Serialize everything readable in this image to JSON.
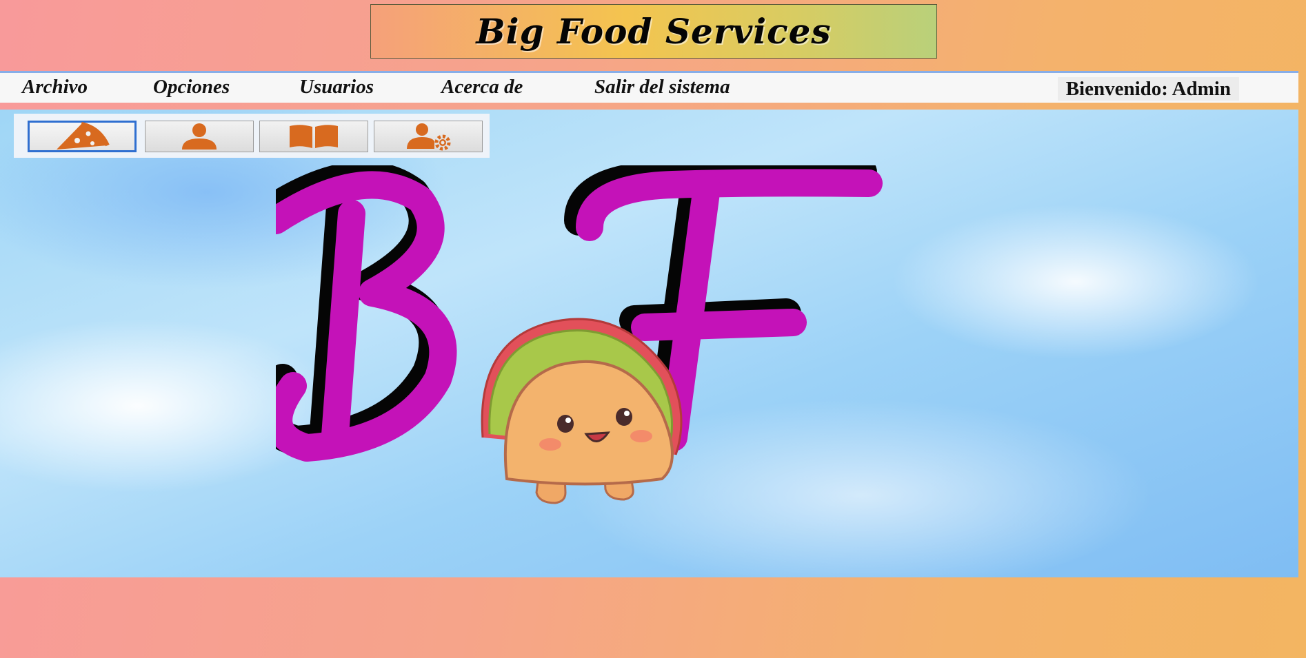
{
  "app": {
    "title": "Big Food Services"
  },
  "menu": {
    "items": [
      {
        "label": "Archivo"
      },
      {
        "label": "Opciones"
      },
      {
        "label": "Usuarios"
      },
      {
        "label": "Acerca de"
      },
      {
        "label": "Salir del sistema"
      }
    ],
    "welcome": "Bienvenido: Admin"
  },
  "toolbar": {
    "buttons": [
      {
        "icon": "pizza-slice-icon",
        "active": true
      },
      {
        "icon": "user-icon",
        "active": false
      },
      {
        "icon": "book-icon",
        "active": false
      },
      {
        "icon": "user-settings-icon",
        "active": false
      }
    ],
    "icon_color": "#d86a1f"
  },
  "logo": {
    "letters": "BF",
    "mascot": "taco-mascot",
    "letter_color": "#c412b8",
    "shadow_color": "#050505"
  },
  "colors": {
    "menu_accent": "#88aee8",
    "active_button_border": "#2f6fd0"
  }
}
